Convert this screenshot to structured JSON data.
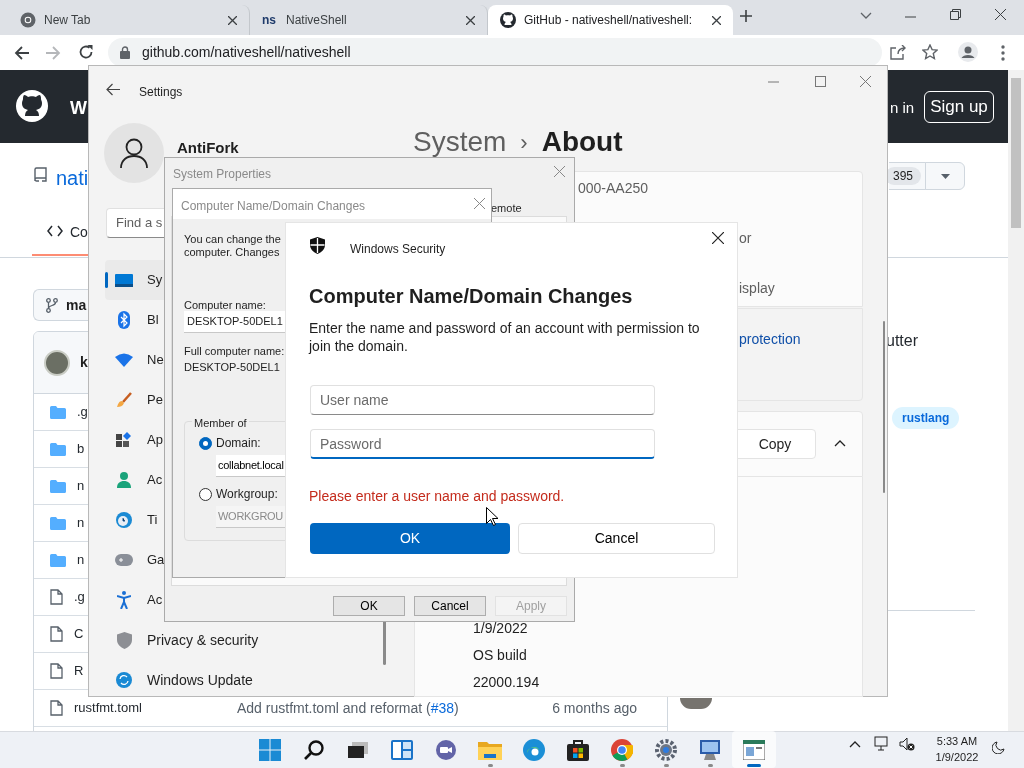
{
  "browser": {
    "tabs": [
      {
        "kind": "chrome",
        "title": "New Tab",
        "selected": false
      },
      {
        "kind": "text",
        "favicon_text": "ns",
        "title": "NativeShell",
        "selected": false
      },
      {
        "kind": "github",
        "title": "GitHub - nativeshell/nativeshell:",
        "selected": true
      }
    ],
    "url": "github.com/nativeshell/nativeshell"
  },
  "github": {
    "header_partial": "W",
    "sign_in_partial": "n in",
    "sign_up": "Sign up",
    "repo_partial": "nati",
    "star_count": "395",
    "code_tab_partial": "Co",
    "branch_partial": "ma",
    "author_partial": "k",
    "files": [
      {
        "kind": "folder",
        "name": ".g"
      },
      {
        "kind": "folder",
        "name": "b"
      },
      {
        "kind": "folder",
        "name": "n"
      },
      {
        "kind": "folder",
        "name": "n"
      },
      {
        "kind": "folder",
        "name": "n"
      },
      {
        "kind": "file",
        "name": ".g"
      },
      {
        "kind": "file",
        "name": "C"
      },
      {
        "kind": "file",
        "name": "R"
      },
      {
        "kind": "file",
        "name": "rustfmt.toml",
        "message_before": "Add rustfmt.toml and reformat (",
        "pr": "#38",
        "message_after": ")",
        "time": "6 months ago"
      }
    ],
    "about_partial": "utter",
    "topics": [
      "rustlang"
    ]
  },
  "settings": {
    "title": "Settings",
    "user": "AntiFork",
    "search_placeholder": "Find a s",
    "nav": [
      {
        "kind": "system",
        "label": "Sy",
        "selected": true
      },
      {
        "kind": "bluetooth",
        "label": "Bl",
        "selected": false
      },
      {
        "kind": "wifi",
        "label": "Ne",
        "selected": false
      },
      {
        "kind": "brush",
        "label": "Pe",
        "selected": false
      },
      {
        "kind": "apps",
        "label": "Ap",
        "selected": false
      },
      {
        "kind": "person",
        "label": "Ac",
        "selected": false
      },
      {
        "kind": "clock",
        "label": "Ti",
        "selected": false
      },
      {
        "kind": "gamepad",
        "label": "Ga",
        "selected": false
      },
      {
        "kind": "accessibility",
        "label": "Ac",
        "selected": false
      },
      {
        "kind": "shield",
        "label": "Privacy & security",
        "selected": false
      },
      {
        "kind": "update",
        "label": "Windows Update",
        "selected": false
      }
    ],
    "breadcrumb": {
      "parent": "System",
      "separator": "›",
      "current": "About"
    },
    "card_texts": [
      "000-AA250",
      "or",
      "isplay"
    ],
    "link_partial": "protection",
    "windows_specs": {
      "copy_button": "Copy",
      "expanded": true,
      "rows": [
        "1/9/2022",
        "OS build",
        "22000.194"
      ]
    }
  },
  "system_properties": {
    "title": "System Properties",
    "tab_partial": "emote",
    "buttons": [
      {
        "label": "OK",
        "disabled": false
      },
      {
        "label": "Cancel",
        "disabled": false
      },
      {
        "label": "Apply",
        "disabled": true
      }
    ]
  },
  "name_changes": {
    "title": "Computer Name/Domain Changes",
    "intro_lines": [
      "You can change the",
      "computer. Changes"
    ],
    "computer_name_label": "Computer name:",
    "computer_name": "DESKTOP-50DEL1",
    "full_name_label": "Full computer name:",
    "full_name": "DESKTOP-50DEL1",
    "member_of": "Member of",
    "options": [
      {
        "label": "Domain:",
        "selected": true,
        "value": "collabnet.local"
      },
      {
        "label": "Workgroup:",
        "selected": false,
        "value": "WORKGROU"
      }
    ]
  },
  "security": {
    "app": "Windows Security",
    "heading": "Computer Name/Domain Changes",
    "message": "Enter the name and password of an account with permission to join the domain.",
    "fields": [
      {
        "placeholder": "User name",
        "focused": false
      },
      {
        "placeholder": "Password",
        "focused": true
      }
    ],
    "error": "Please enter a user name and password.",
    "buttons": [
      {
        "label": "OK",
        "primary": true
      },
      {
        "label": "Cancel",
        "primary": false
      }
    ]
  },
  "taskbar": {
    "apps": [
      {
        "kind": "start",
        "running": false,
        "active": false
      },
      {
        "kind": "search",
        "running": false,
        "active": false
      },
      {
        "kind": "task-view",
        "running": false,
        "active": false
      },
      {
        "kind": "widgets",
        "running": false,
        "active": false
      },
      {
        "kind": "chat",
        "running": false,
        "active": false
      },
      {
        "kind": "folder",
        "running": true,
        "active": false
      },
      {
        "kind": "edge",
        "running": false,
        "active": false
      },
      {
        "kind": "store",
        "running": false,
        "active": false
      },
      {
        "kind": "chrome",
        "running": true,
        "active": false
      },
      {
        "kind": "gear",
        "running": true,
        "active": false
      },
      {
        "kind": "remote",
        "running": true,
        "active": false
      },
      {
        "kind": "sysprops",
        "running": true,
        "active": true
      }
    ],
    "time": "5:33 AM",
    "date": "1/9/2022"
  }
}
